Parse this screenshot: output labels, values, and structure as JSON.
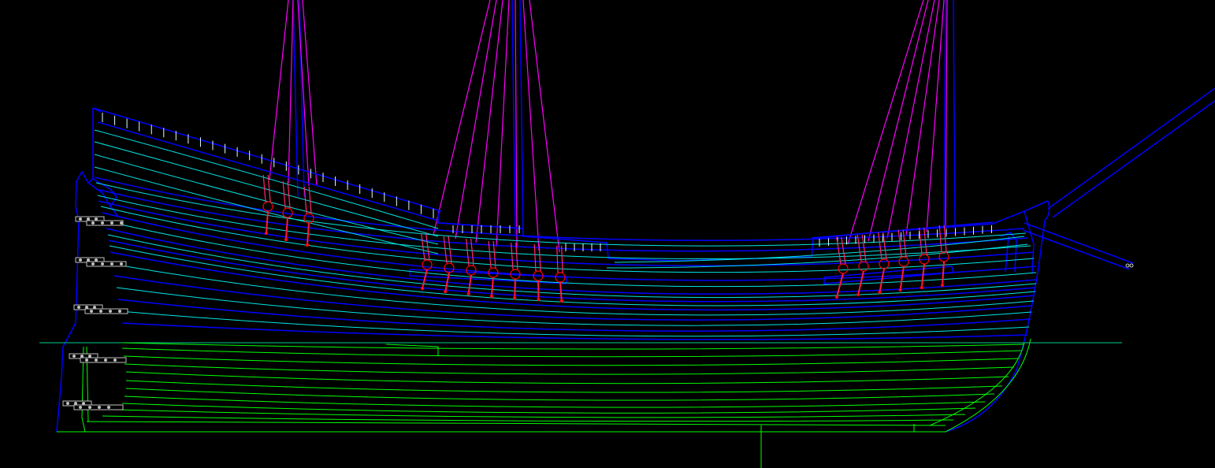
{
  "drawing": {
    "background": "#000000",
    "colors": {
      "hull_outline": "#0000ff",
      "upper_planks": "#00e5e5",
      "lower_planks": "#00ff00",
      "shrouds": "#ff00ff",
      "deadeyes": "#ff0000",
      "chain_plates": "#ff1a60",
      "rudder_pintles": "#c8c8c8",
      "waterline": "#00d08a"
    },
    "layers": [
      "hull-outline",
      "planking-above-waterline",
      "planking-below-waterline",
      "waterline",
      "rudder",
      "channels",
      "deadeyes",
      "shrouds",
      "masts",
      "bowsprit",
      "railing-stanchions"
    ]
  }
}
